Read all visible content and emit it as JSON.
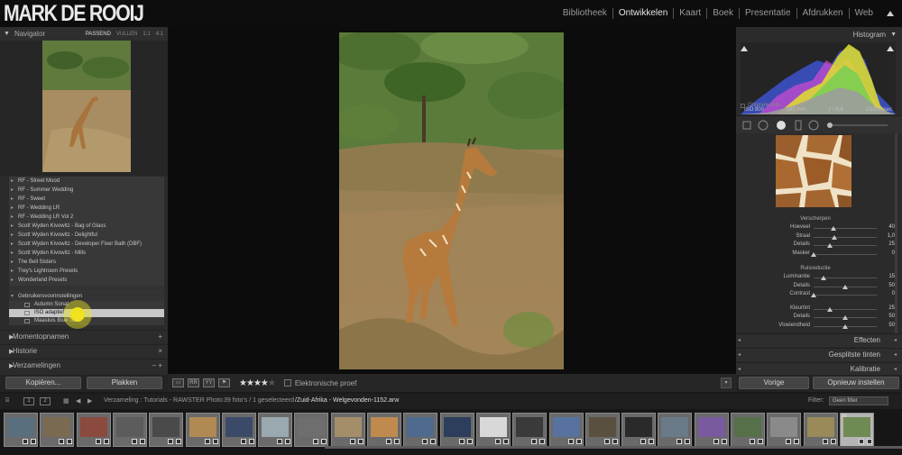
{
  "header": {
    "logo": "MARK DE ROOIJ",
    "modules": [
      "Bibliotheek",
      "Ontwikkelen",
      "Kaart",
      "Boek",
      "Presentatie",
      "Afdrukken",
      "Web"
    ],
    "active_module": "Ontwikkelen"
  },
  "navigator": {
    "title": "Navigator",
    "options": [
      "PASSEND",
      "VULLEN",
      "1:1",
      "4:1"
    ]
  },
  "presets": [
    "RF - Street Mood",
    "RF - Summer Wedding",
    "RF - Sweet",
    "RF - Wedding LR",
    "RF - Wedding LR Vol 2",
    "Scott Wyden Kivowitz - Bag of Glass",
    "Scott Wyden Kivowitz - Delightful",
    "Scott Wyden Kivowitz - Developer Fixer Bath (DBF)",
    "Scott Wyden Kivowitz - Mills",
    "The Bell Sisters",
    "Trey's Lightroom Presets",
    "Wonderland Presets"
  ],
  "user_presets": {
    "title": "Gebruikersvoorinstellingen",
    "items": [
      "Autumn Sonat",
      "ISO adaptief",
      "Maasluis Blue Tone"
    ],
    "selected": "ISO adaptief"
  },
  "left_sections": [
    {
      "label": "Momentopnamen",
      "action": "+"
    },
    {
      "label": "Historie",
      "action": "×"
    },
    {
      "label": "Verzamelingen",
      "action": "– +"
    }
  ],
  "left_buttons": {
    "copy": "Kopiëren...",
    "paste": "Plakken"
  },
  "toolbar": {
    "rating": 4,
    "stars_total": 5,
    "soft_proof": "Elektronische proef"
  },
  "histogram": {
    "title": "Histogram",
    "iso": "ISO 800",
    "focal": "265 mm",
    "aperture": "ƒ / 5,6",
    "shutter": "1/1000 sec",
    "original": "Originele foto"
  },
  "sharpening": {
    "title": "Verscherpen",
    "sliders": [
      {
        "label": "Hoeveel",
        "value": "40",
        "pos": 0.31
      },
      {
        "label": "Straal",
        "value": "1,0",
        "pos": 0.33
      },
      {
        "label": "Details",
        "value": "25",
        "pos": 0.25
      },
      {
        "label": "Masker",
        "value": "0",
        "pos": 0.0
      }
    ]
  },
  "noise": {
    "title": "Ruisreductie",
    "luminance": [
      {
        "label": "Luminantie",
        "value": "15",
        "pos": 0.15
      },
      {
        "label": "Details",
        "value": "50",
        "pos": 0.5
      },
      {
        "label": "Contrast",
        "value": "0",
        "pos": 0.0
      }
    ],
    "color": [
      {
        "label": "Kleurtint",
        "value": "25",
        "pos": 0.25
      },
      {
        "label": "Details",
        "value": "50",
        "pos": 0.5
      },
      {
        "label": "Vloeiendheid",
        "value": "50",
        "pos": 0.5
      }
    ]
  },
  "right_sections": [
    "Effecten",
    "Gesplitste tinten",
    "Kalibratie"
  ],
  "right_buttons": {
    "prev": "Vorige",
    "reset": "Opnieuw instellen"
  },
  "filmstrip_bar": {
    "screens": [
      "1",
      "2"
    ],
    "source": "Verzameling : Tutorials - RAWSTER Photo",
    "count": "39 foto's / 1 geselecteerd",
    "filename": "/Zuid-Afrika - Welgevonden-1152.arw",
    "filter_label": "Filter:",
    "filter_value": "Geen filter"
  },
  "filmstrip": {
    "visible": 24,
    "selected_index": 23,
    "selected_number": "39"
  },
  "colors": {
    "accent_text": "#e6e6e6",
    "highlight": "#f0e21c",
    "panel": "#2b2b2b",
    "background": "#0c0c0c"
  }
}
